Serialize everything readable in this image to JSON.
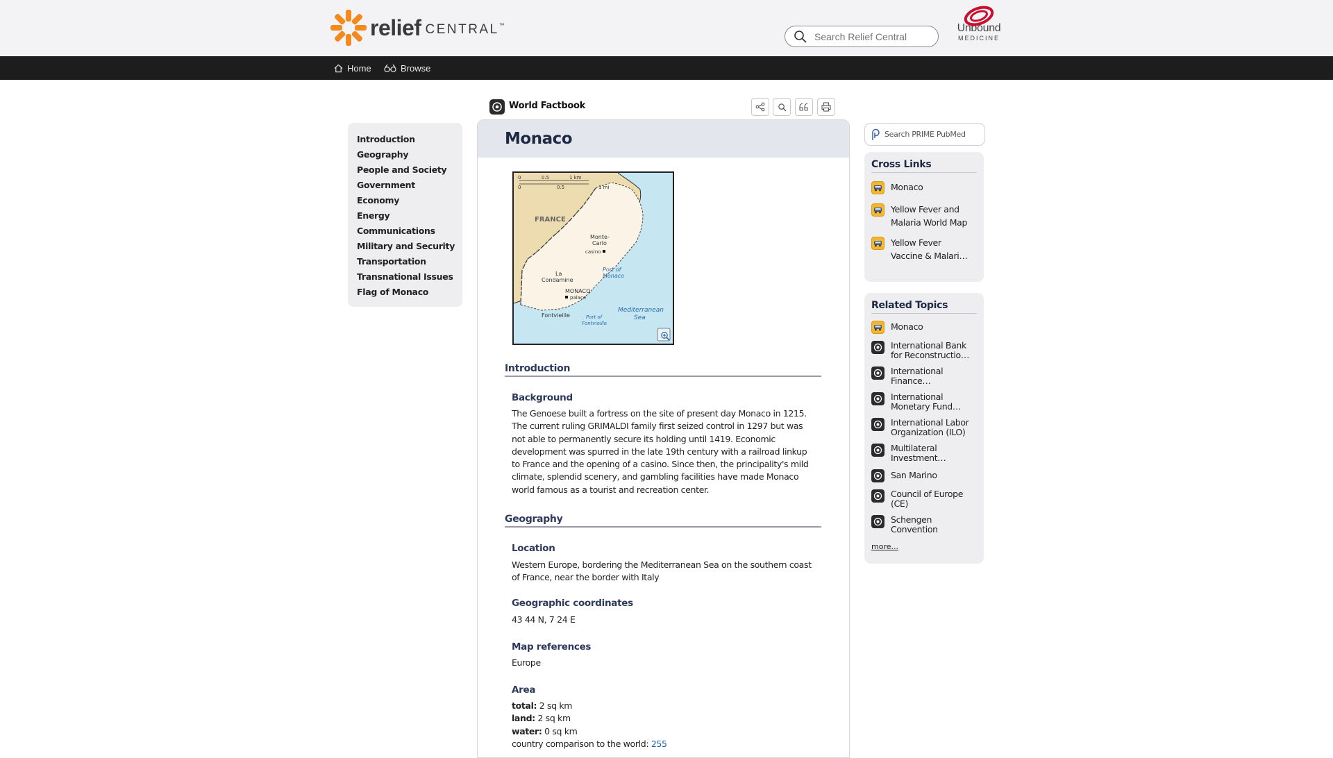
{
  "header": {
    "logo_main": "relief",
    "logo_sub": "CENTRAL",
    "logo_tm": "™",
    "search_placeholder": "Search Relief Central",
    "partner_word": "Unbound",
    "partner_sub": "MEDICINE"
  },
  "nav": {
    "home": "Home",
    "browse": "Browse"
  },
  "toc": [
    "Introduction",
    "Geography",
    "People and Society",
    "Government",
    "Economy",
    "Energy",
    "Communications",
    "Military and Security",
    "Transportation",
    "Transnational Issues",
    "Flag of Monaco"
  ],
  "topic": {
    "source": "World Factbook",
    "title": "Monaco",
    "tools": [
      "share-icon",
      "search-icon",
      "cite-icon",
      "print-icon"
    ]
  },
  "map": {
    "scale_km": [
      "0",
      "0.5",
      "1 km"
    ],
    "scale_mi": [
      "0",
      "0.5",
      "1 mi"
    ],
    "france": "FRANCE",
    "monte_carlo": [
      "Monte-",
      "Carlo",
      "casino"
    ],
    "port_monaco": [
      "Port of",
      "Monaco"
    ],
    "la_condamine": [
      "La",
      "Condamine"
    ],
    "monaco": "MONACO",
    "palace": "palace",
    "sea": [
      "Mediterranean",
      "Sea"
    ],
    "fontvieille": "Fontvieille",
    "port_fontvieille": [
      "Port of",
      "Fontvieille"
    ]
  },
  "sections": {
    "introduction": {
      "heading": "Introduction",
      "background_head": "Background",
      "background_lines": [
        "The Genoese built a fortress on the site of present day Monaco in 1215.",
        "The current ruling GRIMALDI family first seized control in 1297 but was",
        "not able to permanently secure its holding until 1419. Economic",
        "development was spurred in the late 19th century with a railroad linkup",
        "to France and the opening of a casino. Since then, the principality's mild",
        "climate, splendid scenery, and gambling facilities have made Monaco",
        "world famous as a tourist and recreation center."
      ]
    },
    "geography": {
      "heading": "Geography",
      "location_head": "Location",
      "location_lines": [
        "Western Europe, bordering the Mediterranean Sea on the southern coast",
        "of France, near the border with Italy"
      ],
      "coords_head": "Geographic coordinates",
      "coords": "43 44 N, 7 24 E",
      "mapref_head": "Map references",
      "mapref": "Europe",
      "area_head": "Area",
      "area_total_label": "total:",
      "area_total": "2 sq km",
      "area_land_label": "land:",
      "area_land": "2 sq km",
      "area_water_label": "water:",
      "area_water": "0 sq km",
      "area_comp_label": "country comparison to the world:",
      "area_comp": "255"
    }
  },
  "sidebar": {
    "pubmed": "Search PRIME PubMed",
    "cross_title": "Cross Links",
    "cross_links": [
      [
        "Monaco"
      ],
      [
        "Yellow Fever and",
        "Malaria World Map"
      ],
      [
        "Yellow Fever",
        "Vaccine & Malari…"
      ]
    ],
    "related_title": "Related Topics",
    "related": [
      {
        "type": "car",
        "lines": [
          "Monaco"
        ]
      },
      {
        "type": "fact",
        "lines": [
          "International Bank",
          "for Reconstructio…"
        ]
      },
      {
        "type": "fact",
        "lines": [
          "International",
          "Finance…"
        ]
      },
      {
        "type": "fact",
        "lines": [
          "International",
          "Monetary Fund…"
        ]
      },
      {
        "type": "fact",
        "lines": [
          "International Labor",
          "Organization (ILO)"
        ]
      },
      {
        "type": "fact",
        "lines": [
          "Multilateral",
          "Investment…"
        ]
      },
      {
        "type": "fact",
        "lines": [
          "San Marino"
        ]
      },
      {
        "type": "fact",
        "lines": [
          "Council of Europe",
          "(CE)"
        ]
      },
      {
        "type": "fact",
        "lines": [
          "Schengen",
          "Convention"
        ]
      }
    ],
    "more": "more..."
  },
  "colors": {
    "header_bg": "#f3f3f5",
    "nav_bg": "#1d1d1d",
    "logo_orange": "#f28a1e",
    "partner_red": "#c8102e",
    "heading_navy": "#2d3a5c",
    "link_blue": "#1b5fa8",
    "panel_bg": "#eeeef1",
    "title_bar_bg": "#e4e6ee"
  }
}
